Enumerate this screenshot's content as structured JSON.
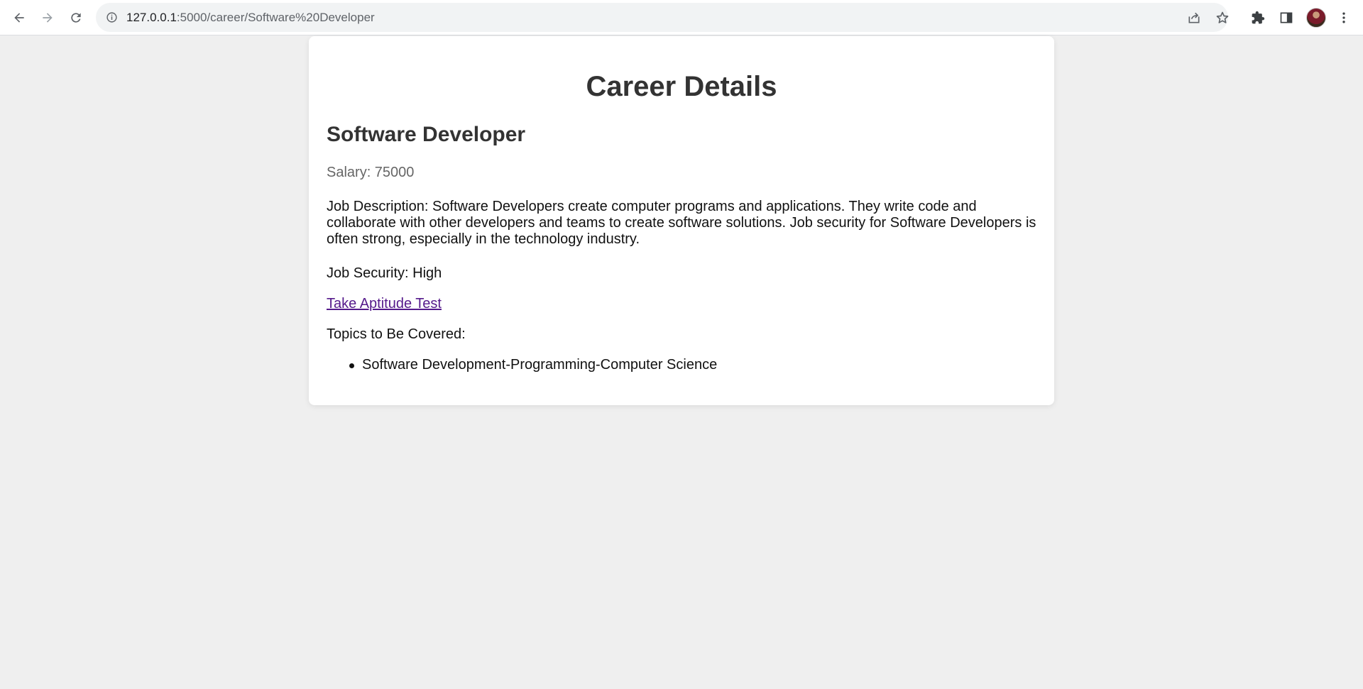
{
  "browser": {
    "url_host": "127.0.0.1",
    "url_path": ":5000/career/Software%20Developer",
    "icons": {
      "back": "back-arrow-icon",
      "forward": "forward-arrow-icon",
      "reload": "reload-icon",
      "info": "info-icon",
      "share": "share-icon",
      "bookmark": "star-icon",
      "extensions": "puzzle-icon",
      "side_panel": "side-panel-icon",
      "menu": "kebab-menu-icon"
    }
  },
  "page": {
    "title": "Career Details",
    "career_name": "Software Developer",
    "salary": "Salary: 75000",
    "description": "Job Description: Software Developers create computer programs and applications. They write code and collaborate with other developers and teams to create software solutions. Job security for Software Developers is often strong, especially in the technology industry.",
    "job_security": "Job Security: High",
    "aptitude_link": "Take Aptitude Test",
    "topics_label": "Topics to Be Covered:",
    "topics": [
      "Software Development-Programming-Computer Science"
    ]
  },
  "colors": {
    "page_bg": "#efefef",
    "card_bg": "#ffffff",
    "heading": "#333333",
    "salary": "#666666",
    "visited_link": "#551a8b"
  }
}
